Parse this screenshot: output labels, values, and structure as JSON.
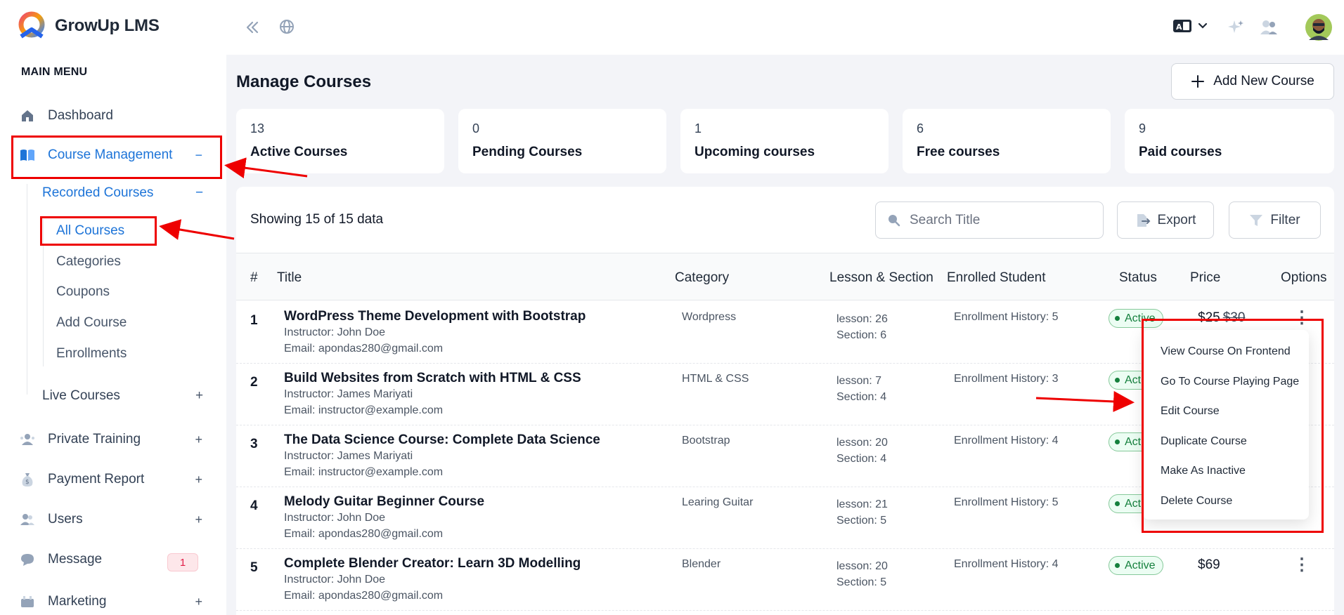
{
  "brand": {
    "name": "GrowUp LMS"
  },
  "sidebar": {
    "menu_head": "MAIN MENU",
    "dashboard": "Dashboard",
    "course_management": {
      "label": "Course Management",
      "sign": "−"
    },
    "recorded_courses": {
      "label": "Recorded Courses",
      "sign": "−"
    },
    "sub_items": [
      "All Courses",
      "Categories",
      "Coupons",
      "Add Course",
      "Enrollments"
    ],
    "live_courses": {
      "label": "Live Courses",
      "sign": "+"
    },
    "private_training": {
      "label": "Private Training",
      "sign": "+"
    },
    "payment_report": {
      "label": "Payment Report",
      "sign": "+"
    },
    "users": {
      "label": "Users",
      "sign": "+"
    },
    "message": {
      "label": "Message",
      "badge": "1"
    },
    "marketing": {
      "label": "Marketing",
      "sign": "+"
    }
  },
  "topbar": {
    "icons": [
      "collapse-icon",
      "globe-icon",
      "translate-icon",
      "sparkle-icon",
      "user-switch-icon",
      "avatar"
    ]
  },
  "page": {
    "title": "Manage Courses",
    "add_button": "Add New Course"
  },
  "stats": [
    {
      "num": "13",
      "label": "Active Courses"
    },
    {
      "num": "0",
      "label": "Pending Courses"
    },
    {
      "num": "1",
      "label": "Upcoming courses"
    },
    {
      "num": "6",
      "label": "Free courses"
    },
    {
      "num": "9",
      "label": "Paid courses"
    }
  ],
  "table": {
    "showing": "Showing 15 of 15 data",
    "search_placeholder": "Search Title",
    "export_label": "Export",
    "filter_label": "Filter",
    "headers": [
      "#",
      "Title",
      "Category",
      "Lesson & Section",
      "Enrolled Student",
      "Status",
      "Price",
      "Options"
    ],
    "rows": [
      {
        "num": "1",
        "title": "WordPress Theme Development with Bootstrap",
        "instructor": "Instructor: John Doe",
        "email": "Email: apondas280@gmail.com",
        "category": "Wordpress",
        "lesson": "lesson: 26",
        "section": "Section: 6",
        "enroll": "Enrollment History: 5",
        "status": "Active",
        "price": "$25",
        "old_price": "$30"
      },
      {
        "num": "2",
        "title": "Build Websites from Scratch with HTML & CSS",
        "instructor": "Instructor: James Mariyati",
        "email": "Email: instructor@example.com",
        "category": "HTML & CSS",
        "lesson": "lesson: 7",
        "section": "Section: 4",
        "enroll": "Enrollment History: 3",
        "status": "Acti",
        "price": "",
        "old_price": ""
      },
      {
        "num": "3",
        "title": "The Data Science Course: Complete Data Science",
        "instructor": "Instructor: James Mariyati",
        "email": "Email: instructor@example.com",
        "category": "Bootstrap",
        "lesson": "lesson: 20",
        "section": "Section: 4",
        "enroll": "Enrollment History: 4",
        "status": "Acti",
        "price": "",
        "old_price": ""
      },
      {
        "num": "4",
        "title": "Melody Guitar Beginner Course",
        "instructor": "Instructor: John Doe",
        "email": "Email: apondas280@gmail.com",
        "category": "Learing Guitar",
        "lesson": "lesson: 21",
        "section": "Section: 5",
        "enroll": "Enrollment History: 5",
        "status": "Acti",
        "price": "",
        "old_price": ""
      },
      {
        "num": "5",
        "title": "Complete Blender Creator: Learn 3D Modelling",
        "instructor": "Instructor: John Doe",
        "email": "Email: apondas280@gmail.com",
        "category": "Blender",
        "lesson": "lesson: 20",
        "section": "Section: 5",
        "enroll": "Enrollment History: 4",
        "status": "Active",
        "price": "$69",
        "old_price": ""
      }
    ]
  },
  "dropdown": {
    "items": [
      "View Course On Frontend",
      "Go To Course Playing Page",
      "Edit Course",
      "Duplicate Course",
      "Make As Inactive",
      "Delete Course"
    ]
  },
  "colors": {
    "accent": "#1d74d8",
    "annotation": "#ee0000",
    "status_green": "#15803d"
  }
}
